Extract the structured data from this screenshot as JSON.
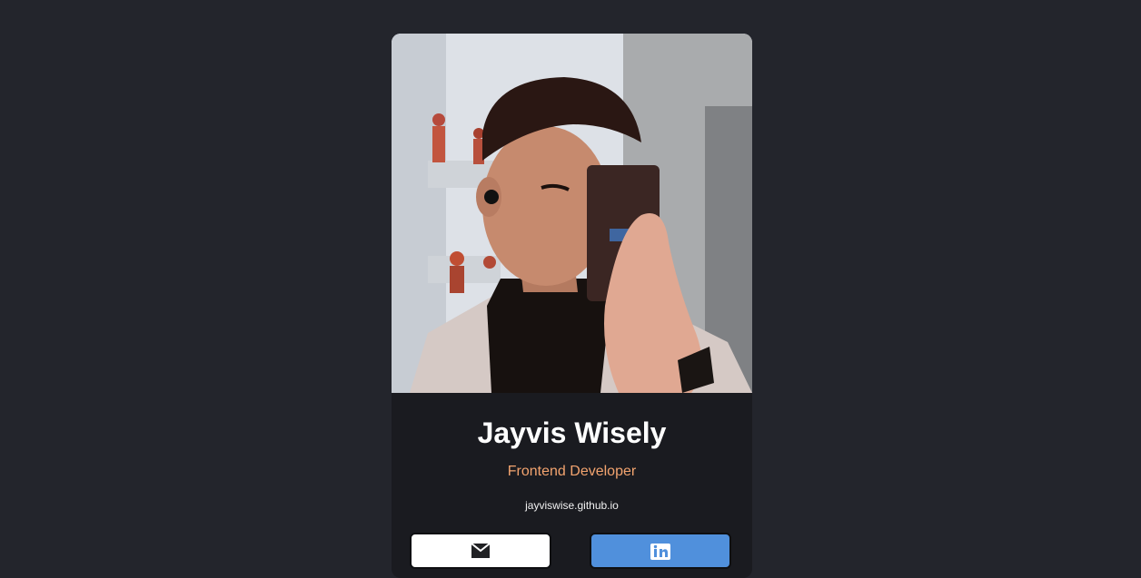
{
  "profile": {
    "name": "Jayvis Wisely",
    "role": "Frontend Developer",
    "website": "jayviswise.github.io",
    "photo_alt": "profile photo"
  },
  "buttons": {
    "email_icon": "mail-icon",
    "linkedin_icon": "linkedin-icon"
  },
  "colors": {
    "page_bg": "#23252c",
    "card_bg": "#1a1b20",
    "name": "#ffffff",
    "role": "#f3a46f",
    "linkedin": "#5090dc"
  }
}
